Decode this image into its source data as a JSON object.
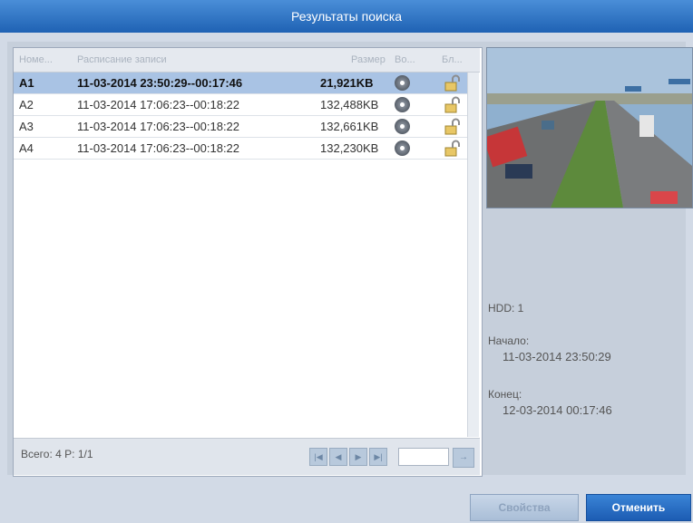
{
  "window": {
    "title": "Результаты поиска"
  },
  "table": {
    "columns": [
      "Номе...",
      "Расписание записи",
      "Размер",
      "Во...",
      "Бл..."
    ],
    "rows": [
      {
        "no": "A1",
        "time": "11-03-2014 23:50:29--00:17:46",
        "size": "21,921KB"
      },
      {
        "no": "A2",
        "time": "11-03-2014 17:06:23--00:18:22",
        "size": "132,488KB"
      },
      {
        "no": "A3",
        "time": "11-03-2014 17:06:23--00:18:22",
        "size": "132,661KB"
      },
      {
        "no": "A4",
        "time": "11-03-2014 17:06:23--00:18:22",
        "size": "132,230KB"
      }
    ],
    "total": "Всего: 4  P: 1/1"
  },
  "pagination": {
    "first": "|◀",
    "prev": "◀",
    "next": "▶",
    "last": "▶|",
    "go": "→"
  },
  "details": {
    "hdd": "HDD: 1",
    "start_label": "Начало:",
    "start_value": "11-03-2014 23:50:29",
    "end_label": "Конец:",
    "end_value": "12-03-2014 00:17:46"
  },
  "buttons": {
    "properties": "Свойства",
    "cancel": "Отменить"
  },
  "colors": {
    "titlebar": "#1f62b4",
    "selected_row": "#a9c3e4",
    "accent": "#1c5cb3"
  },
  "icons": {
    "play": "play-icon",
    "lock": "lock-icon"
  }
}
